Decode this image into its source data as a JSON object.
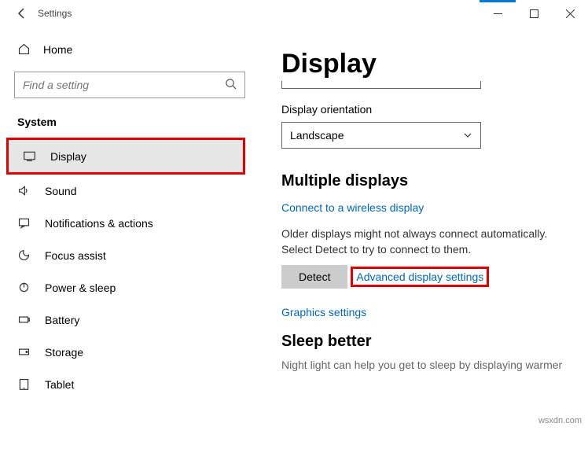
{
  "titlebar": {
    "title": "Settings"
  },
  "sidebar": {
    "home": "Home",
    "search_placeholder": "Find a setting",
    "section": "System",
    "items": [
      {
        "label": "Display"
      },
      {
        "label": "Sound"
      },
      {
        "label": "Notifications & actions"
      },
      {
        "label": "Focus assist"
      },
      {
        "label": "Power & sleep"
      },
      {
        "label": "Battery"
      },
      {
        "label": "Storage"
      },
      {
        "label": "Tablet"
      }
    ]
  },
  "content": {
    "heading": "Display",
    "orientation_label": "Display orientation",
    "orientation_value": "Landscape",
    "multi_heading": "Multiple displays",
    "connect_link": "Connect to a wireless display",
    "older_text": "Older displays might not always connect automatically. Select Detect to try to connect to them.",
    "detect": "Detect",
    "advanced_link": "Advanced display settings",
    "graphics_link": "Graphics settings",
    "sleep_heading": "Sleep better",
    "sleep_desc": "Night light can help you get to sleep by displaying warmer"
  },
  "watermark": "wsxdn.com"
}
